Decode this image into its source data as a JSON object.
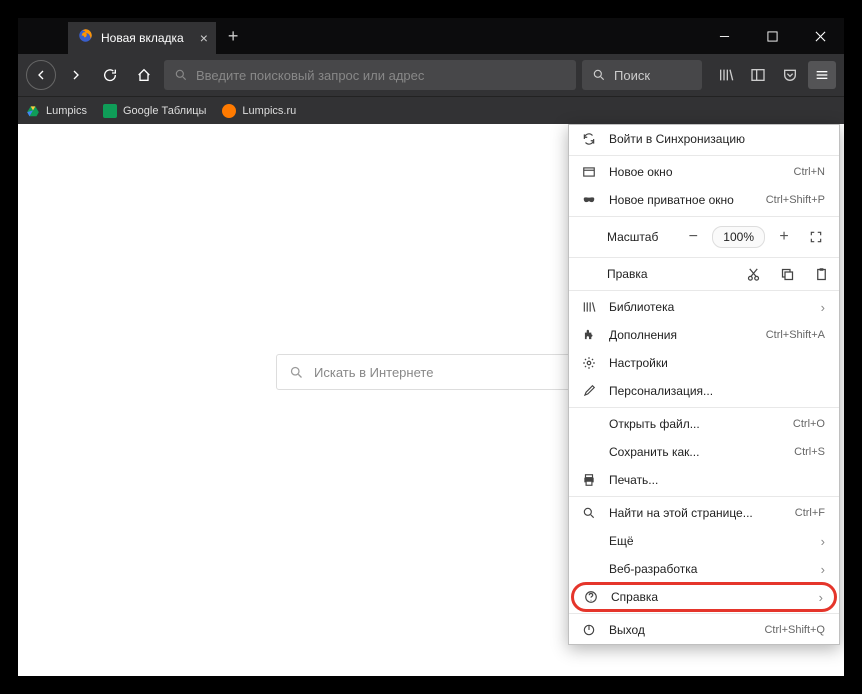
{
  "tab": {
    "title": "Новая вкладка"
  },
  "urlbar": {
    "placeholder": "Введите поисковый запрос или адрес"
  },
  "searchbar": {
    "placeholder": "Поиск"
  },
  "bookmarks": [
    {
      "label": "Lumpics",
      "color": "#00a850"
    },
    {
      "label": "Google Таблицы",
      "color": "#0f9d58"
    },
    {
      "label": "Lumpics.ru",
      "color": "#ff7a00"
    }
  ],
  "homesearch": {
    "placeholder": "Искать в Интернете"
  },
  "menu": {
    "sync": "Войти в Синхронизацию",
    "newWindow": {
      "label": "Новое окно",
      "accel": "Ctrl+N"
    },
    "newPrivate": {
      "label": "Новое приватное окно",
      "accel": "Ctrl+Shift+P"
    },
    "zoom": {
      "label": "Масштаб",
      "value": "100%"
    },
    "edit": {
      "label": "Правка"
    },
    "library": "Библиотека",
    "addons": {
      "label": "Дополнения",
      "accel": "Ctrl+Shift+A"
    },
    "settings": "Настройки",
    "customize": "Персонализация...",
    "openFile": {
      "label": "Открыть файл...",
      "accel": "Ctrl+O"
    },
    "saveAs": {
      "label": "Сохранить как...",
      "accel": "Ctrl+S"
    },
    "print": "Печать...",
    "find": {
      "label": "Найти на этой странице...",
      "accel": "Ctrl+F"
    },
    "more": "Ещё",
    "webdev": "Веб-разработка",
    "help": "Справка",
    "exit": {
      "label": "Выход",
      "accel": "Ctrl+Shift+Q"
    }
  }
}
